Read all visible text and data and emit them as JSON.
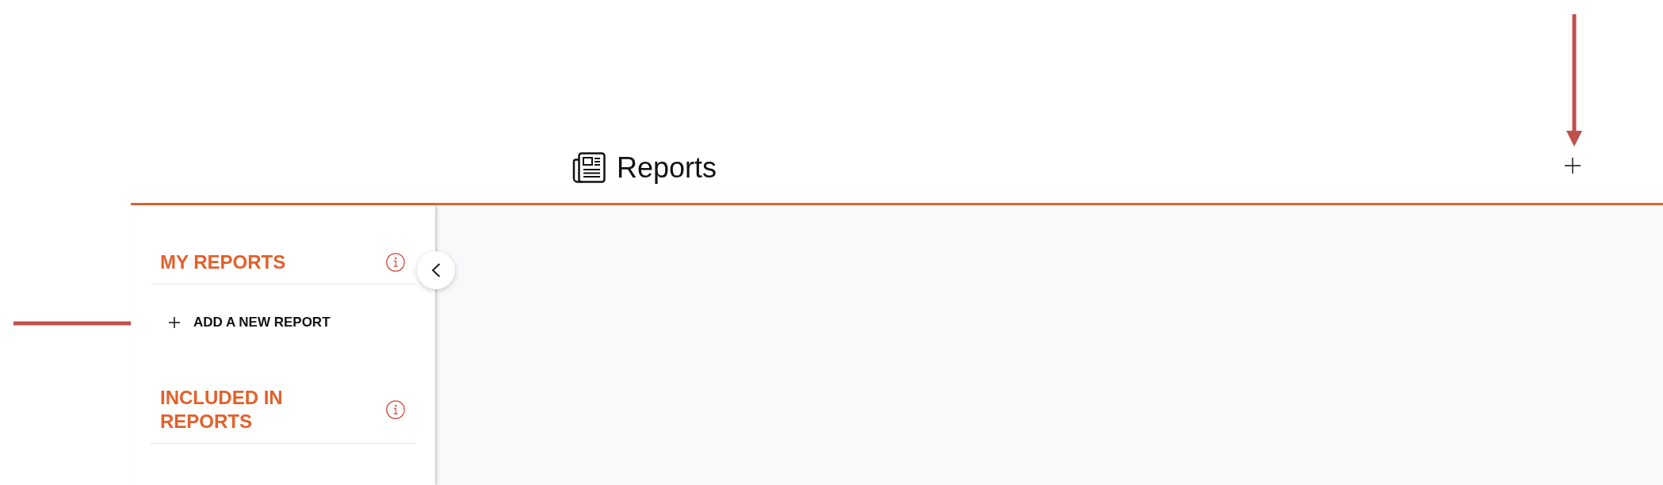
{
  "header": {
    "title": "Reports",
    "add_button": {
      "annotated": true
    }
  },
  "sidebar": {
    "sections": [
      {
        "title": "MY REPORTS",
        "actions": [
          {
            "label": "ADD A NEW REPORT",
            "annotated": true
          }
        ]
      },
      {
        "title": "INCLUDED IN REPORTS"
      }
    ]
  }
}
